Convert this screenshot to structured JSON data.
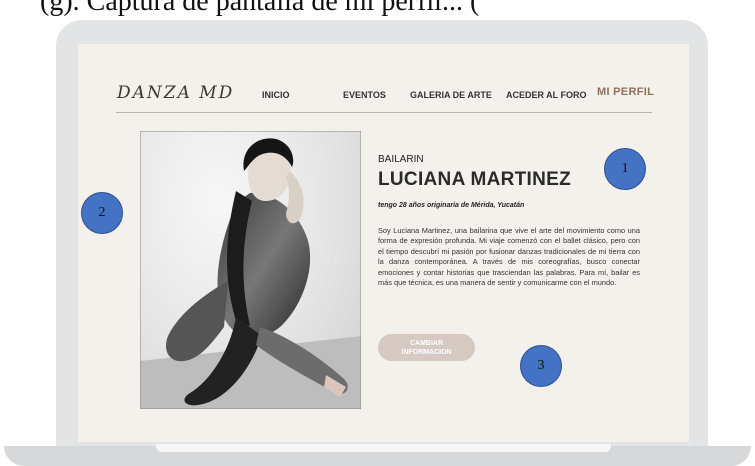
{
  "caption_fragment": "(g). Captura de pantalla de mi perfil...                (",
  "header": {
    "logo": "DANZA MD",
    "nav": [
      "INICIO",
      "EVENTOS",
      "GALERIA DE ARTE",
      "ACEDER AL FORO"
    ],
    "profile_link": "MI PERFIL"
  },
  "profile": {
    "role": "BAILARIN",
    "name": "LUCIANA MARTINEZ",
    "tagline": "tengo  28 años originaria de Mérida, Yucatán",
    "bio": "Soy Luciana Martinez, una bailarina que vive el arte del movimiento como una forma de expresión profunda. Mi viaje comenzó con el ballet clásico, pero con el tiempo descubrí mi pasión por fusionar danzas tradicionales de mi tierra con la danza contemporánea. A través de mis coreografías, busco conectar emociones y contar historias que trasciendan las palabras. Para mí, bailar es más que técnica, es una manera de sentir y comunicarme con el mundo.",
    "button_label": "CAMBIAR INFORMACION"
  },
  "markers": [
    "1",
    "2",
    "3"
  ],
  "colors": {
    "screen_background": "#f4f1ec",
    "profile_accent": "#8f7159",
    "button_background": "#d5c9c2",
    "marker_fill": "#4472c4"
  }
}
